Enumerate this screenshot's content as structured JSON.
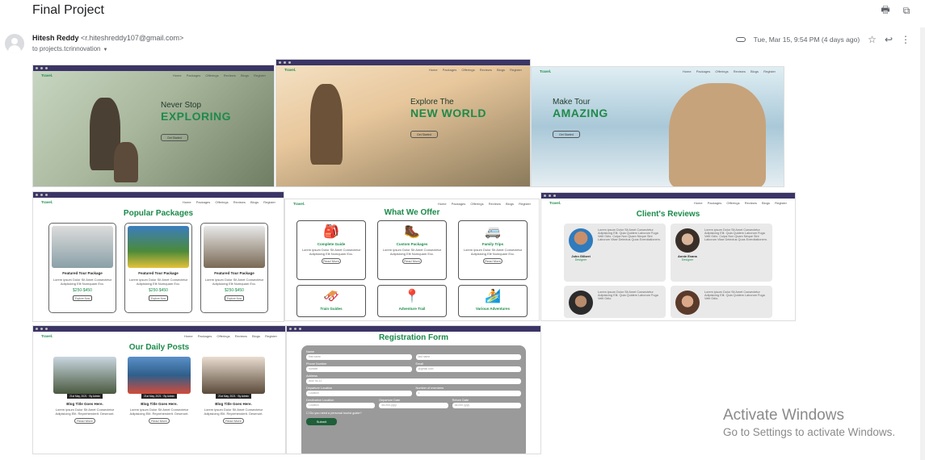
{
  "email": {
    "subject": "Final Project",
    "sender_name": "Hitesh Reddy",
    "sender_email": "<r.hiteshreddy107@gmail.com>",
    "recipient": "to projects.tcrinnovation",
    "timestamp": "Tue, Mar 15, 9:54 PM (4 days ago)"
  },
  "icons": {
    "print": "print-icon",
    "open_new": "open-in-new-icon",
    "attachment": "attachment-icon",
    "star": "star-icon",
    "reply": "reply-icon",
    "more": "more-vert-icon"
  },
  "site": {
    "logo": "Travel.",
    "nav": [
      "Home",
      "Packages",
      "Offerings",
      "Reviews",
      "Blogs",
      "Register"
    ],
    "heroes": [
      {
        "small": "Never Stop",
        "big": "EXPLORING",
        "button": "Get Started"
      },
      {
        "small": "Explore The",
        "big": "NEW WORLD",
        "button": "Get Started"
      },
      {
        "small": "Make Tour",
        "big": "AMAZING",
        "button": "Get Started"
      }
    ],
    "packages": {
      "title": "Popular Packages",
      "cards": [
        {
          "title": "Featured Tour Package",
          "desc": "Lorem ipsum Dolor Sit Amet Consectetur Adipisicing Elit Numquam Exc.",
          "price": "$250-$450",
          "button": "Explore Now"
        },
        {
          "title": "Featured Tour Package",
          "desc": "Lorem ipsum Dolor Sit Amet Consectetur Adipisicing Elit Numquam Exc.",
          "price": "$250-$450",
          "button": "Explore Now"
        },
        {
          "title": "Featured Tour Package",
          "desc": "Lorem ipsum Dolor Sit Amet Consectetur Adipisicing Elit Numquam Exc.",
          "price": "$250-$450",
          "button": "Explore Now"
        }
      ]
    },
    "offers": {
      "title": "What We Offer",
      "cards": [
        {
          "glyph": "🎒",
          "title": "Complete Guide",
          "desc": "Lorem ipsum Dolor Sit Amet Consectetur Adipisicing Elit Numquam Exc.",
          "button": "Read More"
        },
        {
          "glyph": "🥾",
          "title": "Custom Packages",
          "desc": "Lorem ipsum Dolor Sit Amet Consectetur Adipisicing Elit Numquam Exc.",
          "button": "Read More"
        },
        {
          "glyph": "🚐",
          "title": "Family Trips",
          "desc": "Lorem ipsum Dolor Sit Amet Consectetur Adipisicing Elit Numquam Exc.",
          "button": "Read More"
        },
        {
          "glyph": "🛷",
          "title": "Train Guides",
          "desc": "",
          "button": ""
        },
        {
          "glyph": "📍",
          "title": "Adventure Trail",
          "desc": "",
          "button": ""
        },
        {
          "glyph": "🏄",
          "title": "Various Adventures",
          "desc": "",
          "button": ""
        }
      ]
    },
    "reviews": {
      "title": "Client's Reviews",
      "cards": [
        {
          "name": "John Gilbert",
          "role": "Designer",
          "text": "Lorem ipsum Dolor Sit Amet Consectetur Adipisicing Elit. Quia Quidem Laborum Fuga Velit Odio. Culpa Non Quam Neque Sint Laborum Vitae Delectus Quos Exercitationem."
        },
        {
          "name": "Annie Evans",
          "role": "Designer",
          "text": "Lorem ipsum Dolor Sit Amet Consectetur Adipisicing Elit. Quia Quidem Laborum Fuga Velit Odio. Culpa Non Quam Neque Sint Laborum Vitae Delectus Quos Exercitationem."
        },
        {
          "name": "",
          "role": "",
          "text": "Lorem ipsum Dolor Sit Amet Consectetur Adipisicing Elit. Quia Quidem Laborum Fuga Velit Odio."
        },
        {
          "name": "",
          "role": "",
          "text": "Lorem ipsum Dolor Sit Amet Consectetur Adipisicing Elit. Quia Quidem Laborum Fuga Velit Odio."
        }
      ]
    },
    "posts": {
      "title": "Our Daily Posts",
      "cards": [
        {
          "date": "21st May, 2021",
          "author": "By Admin",
          "title": "Blog Title Goes Here.",
          "desc": "Lorem ipsum Dolor Sit Amet Consectetur Adipisicing Elit. Reprehenderit. Deserunt.",
          "button": "Read More"
        },
        {
          "date": "21st May, 2021",
          "author": "By Admin",
          "title": "Blog Title Goes Here.",
          "desc": "Lorem ipsum Dolor Sit Amet Consectetur Adipisicing Elit. Reprehenderit. Deserunt.",
          "button": "Read More"
        },
        {
          "date": "21st May, 2021",
          "author": "By Admin",
          "title": "Blog Title Goes Here.",
          "desc": "Lorem ipsum Dolor Sit Amet Consectetur Adipisicing Elit. Reprehenderit. Deserunt.",
          "button": "Read More"
        }
      ]
    },
    "registration": {
      "title": "Registration Form",
      "name_label": "Name",
      "first_name": "first name",
      "last_name": "last name",
      "phone_label": "Phone Number",
      "phone_ph": "number",
      "email_label": "Email",
      "email_ph": "@gmail.com",
      "address_label": "Address",
      "address_ph": "door no-12",
      "departure_label": "Departure Location",
      "departure_ph": "Location",
      "members_label": "Number of members",
      "members_val": "1",
      "destination_label": "Destination Location",
      "destination_ph": "Location",
      "dep_date_label": "Departure Date",
      "ret_date_label": "Return Date",
      "date_ph": "dd-mm-yyyy",
      "tour_guide": "Do you need a personal tourist guide?",
      "submit": "Submit"
    }
  },
  "watermark": {
    "title": "Activate Windows",
    "subtitle": "Go to Settings to activate Windows."
  }
}
